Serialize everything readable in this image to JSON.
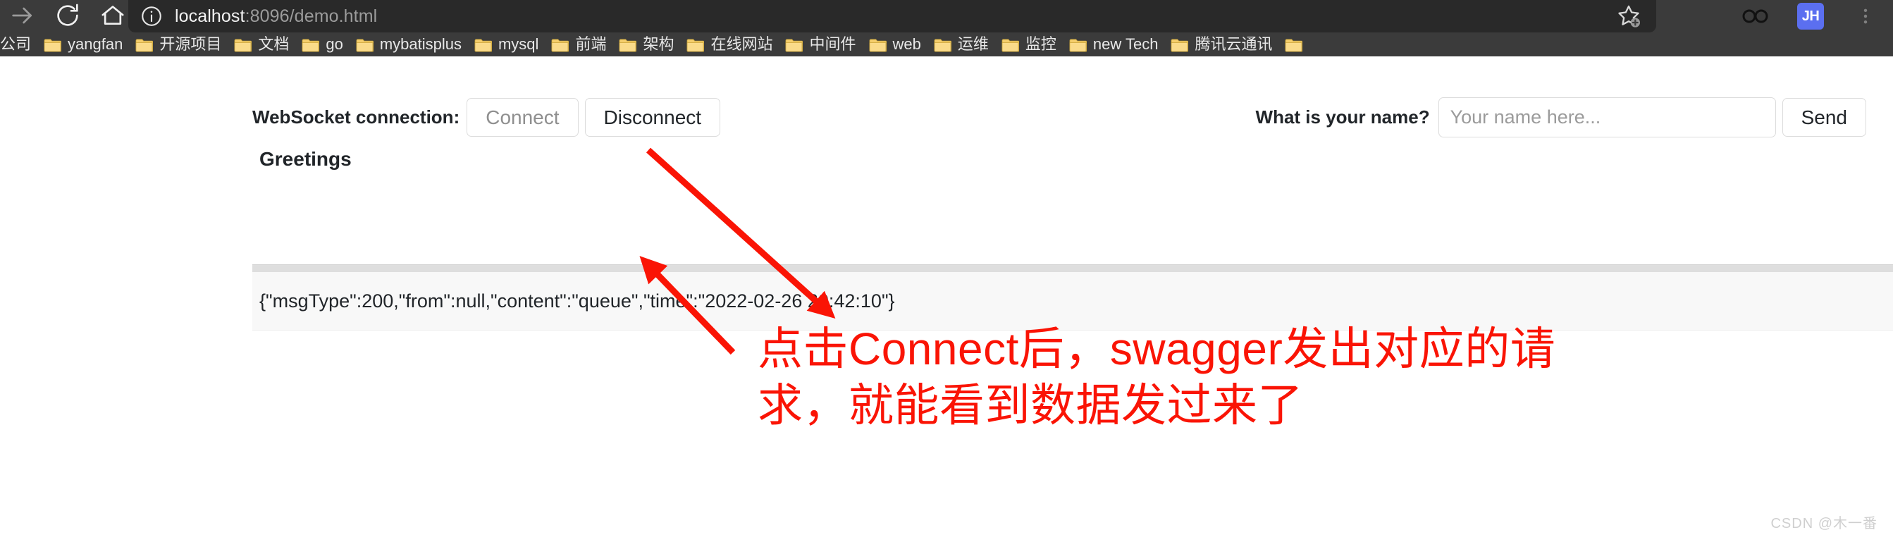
{
  "browser": {
    "nav_buttons": [
      {
        "name": "forward-arrow-icon",
        "label": "Forward"
      },
      {
        "name": "reload-icon",
        "label": "Reload"
      },
      {
        "name": "home-icon",
        "label": "Home"
      }
    ],
    "omnibox": {
      "info_icon": "info-circle-icon",
      "host": "localhost",
      "path": ":8096/demo.html",
      "full_url": "localhost:8096/demo.html"
    },
    "right_icons": [
      {
        "name": "add-favorite-star-icon",
        "label": "Add to favorites"
      },
      {
        "name": "collections-infinity-icon",
        "label": "Collections"
      }
    ],
    "profile": {
      "name": "profile-avatar",
      "initials": "JH",
      "color": "#5b6ff0"
    },
    "bookmarks": [
      {
        "label": "公司"
      },
      {
        "label": "yangfan"
      },
      {
        "label": "开源项目"
      },
      {
        "label": "文档"
      },
      {
        "label": "go"
      },
      {
        "label": "mybatisplus"
      },
      {
        "label": "mysql"
      },
      {
        "label": "前端"
      },
      {
        "label": "架构"
      },
      {
        "label": "在线网站"
      },
      {
        "label": "中间件"
      },
      {
        "label": "web"
      },
      {
        "label": "运维"
      },
      {
        "label": "监控"
      },
      {
        "label": "new Tech"
      },
      {
        "label": "腾讯云通讯"
      },
      {
        "label": ""
      }
    ]
  },
  "page": {
    "websocket_label": "WebSocket connection:",
    "connect_button": "Connect",
    "disconnect_button": "Disconnect",
    "name_label": "What is your name?",
    "name_placeholder": "Your name here...",
    "name_value": "",
    "send_button": "Send",
    "greetings_title": "Greetings",
    "messages": [
      "{\"msgType\":200,\"from\":null,\"content\":\"queue\",\"time\":\"2022-02-26 20:42:10\"}"
    ]
  },
  "annotation": {
    "line1": "点击Connect后，swagger发出对应的请",
    "line2": "求，就能看到数据发过来了",
    "color": "#fa1405"
  },
  "watermark": "CSDN @木一番"
}
